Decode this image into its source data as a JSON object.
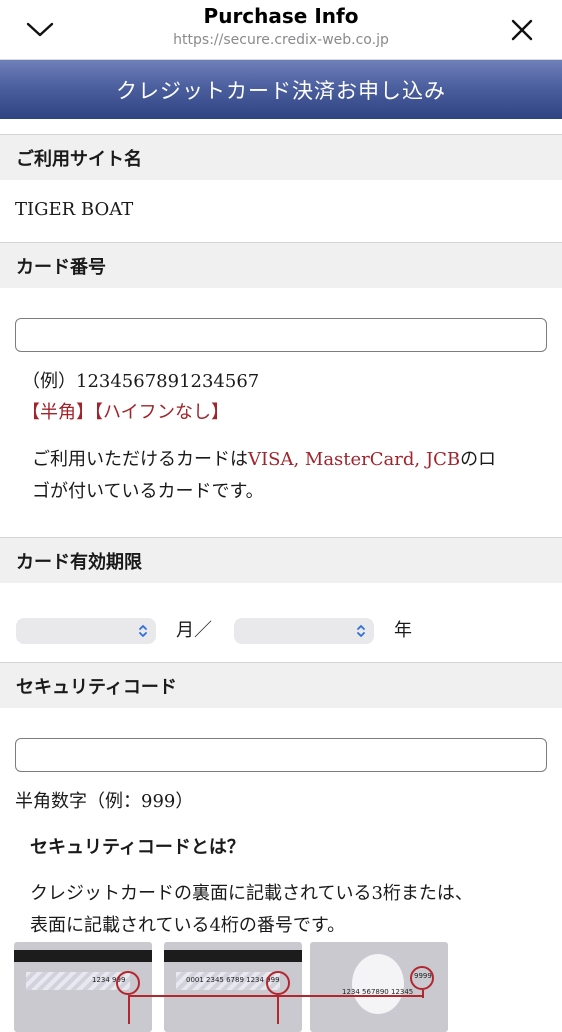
{
  "browser": {
    "title": "Purchase Info",
    "url": "https://secure.credix-web.co.jp",
    "left_icon": "chevron-down-icon",
    "right_icon": "close-icon"
  },
  "banner": {
    "title": "クレジットカード決済お申し込み"
  },
  "site": {
    "heading": "ご利用サイト名",
    "name": "TIGER BOAT"
  },
  "card_number": {
    "heading": "カード番号",
    "value": "",
    "example": "（例）1234567891234567",
    "note1": "【半角】",
    "note2": "【ハイフンなし】",
    "info_prefix": "ご利用いただけるカードは",
    "info_brands": "VISA, MasterCard, JCB",
    "info_suffix": "のロ",
    "info_line2": "ゴが付いているカードです。"
  },
  "expiry": {
    "heading": "カード有効期限",
    "month_value": "",
    "month_label": "月／",
    "year_value": "",
    "year_label": "年"
  },
  "security": {
    "heading": "セキュリティコード",
    "value": "",
    "hint": "半角数字（例：999）",
    "subheading": "セキュリティコードとは？",
    "desc_line1": "クレジットカードの裏面に記載されている3桁または、",
    "desc_line2": "表面に記載されている4桁の番号です。",
    "card_back_1": "1234  999",
    "card_back_2": "0001 2345 6789 1234  999",
    "card_front": "1234  567890  12345",
    "card_front_code": "9999"
  },
  "colors": {
    "accent_red": "#a1232b",
    "banner_blue": "#3d5091"
  }
}
